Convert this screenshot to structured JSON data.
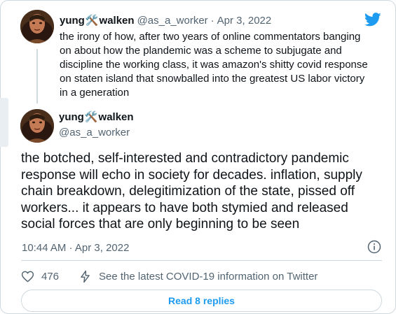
{
  "reply_tweet": {
    "display_name": "yung🛠️walken",
    "name_left": "yung",
    "name_right": "walken",
    "handle": "@as_a_worker",
    "separator": "·",
    "date": "Apr 3, 2022",
    "text": "the irony of how, after two years of online commentators banging on about how the plandemic was a scheme to subjugate and discipline the working class, it was amazon's shitty covid response on staten island that snowballed into the greatest US labor victory in a generation"
  },
  "main_tweet": {
    "display_name": "yung🛠️walken",
    "name_left": "yung",
    "name_right": "walken",
    "handle": "@as_a_worker",
    "text": "the botched, self-interested and contradictory pandemic response will echo in society for decades. inflation, supply chain breakdown, delegitimization of the state, pissed off workers... it appears to have both stymied and released social forces that are only beginning to be seen",
    "timestamp": "10:44 AM · Apr 3, 2022",
    "like_count": "476",
    "info_link": "See the latest COVID-19 information on Twitter",
    "read_replies_label": "Read 8 replies"
  },
  "colors": {
    "accent": "#1d9bf0",
    "secondary_text": "#536471",
    "border": "#cfd9de",
    "text": "#0f1419"
  },
  "icons": {
    "brand": "twitter-bird-icon",
    "like": "heart-icon",
    "info_link": "lightning-icon",
    "tweet_info": "info-icon",
    "name_emoji": "hammer-wrench-icon"
  }
}
